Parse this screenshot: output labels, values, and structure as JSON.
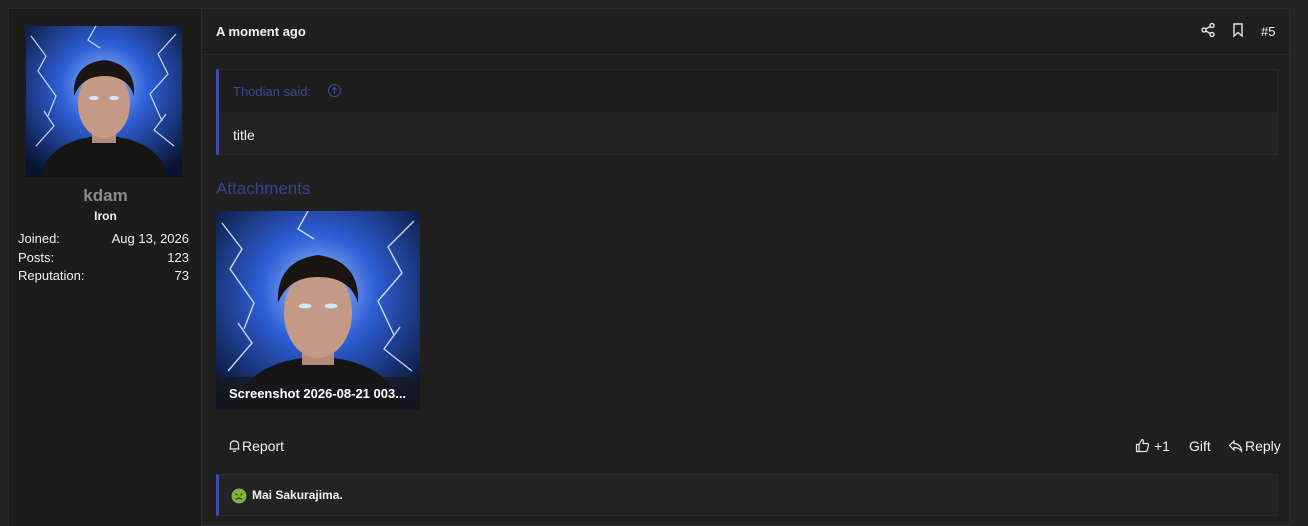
{
  "user": {
    "name": "kdam",
    "title": "Iron",
    "stats": [
      {
        "label": "Joined:",
        "value": "Aug 13, 2026"
      },
      {
        "label": "Posts:",
        "value": "123"
      },
      {
        "label": "Reputation:",
        "value": "73"
      }
    ]
  },
  "header": {
    "time": "A moment ago",
    "post_number": "#5"
  },
  "quote": {
    "author": "Thodian said:",
    "body": "title"
  },
  "attachments": {
    "title": "Attachments",
    "items": [
      {
        "caption": "Screenshot 2026-08-21 003..."
      }
    ]
  },
  "actions": {
    "report": "Report",
    "like": "+1",
    "gift": "Gift",
    "reply": "Reply"
  },
  "reactions": {
    "text": "Mai Sakurajima."
  },
  "colors": {
    "accent": "#3b4fa8",
    "link_muted": "#3a4a90",
    "background": "#1f1f1f"
  }
}
